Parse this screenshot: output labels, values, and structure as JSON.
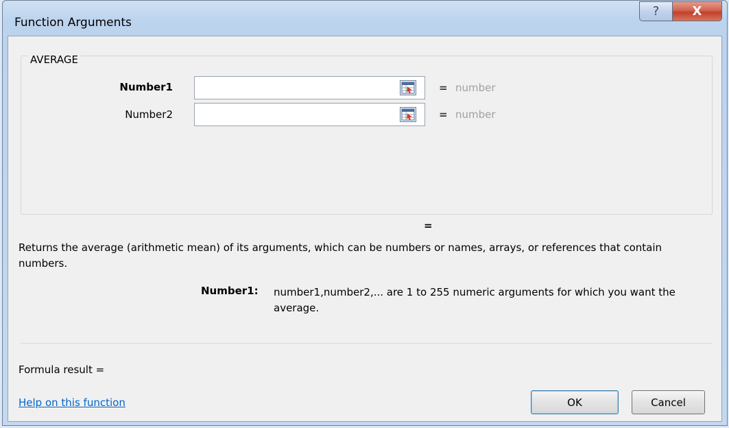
{
  "window": {
    "title": "Function Arguments",
    "help_glyph": "?",
    "close_glyph": "X"
  },
  "function": {
    "name": "AVERAGE"
  },
  "arguments": [
    {
      "label": "Number1",
      "value": "",
      "equals": "=",
      "result": "number",
      "bold": true
    },
    {
      "label": "Number2",
      "value": "",
      "equals": "=",
      "result": "number",
      "bold": false
    }
  ],
  "function_result_equals": "=",
  "description": "Returns the average (arithmetic mean) of its arguments, which can be numbers or names, arrays, or references that contain numbers.",
  "argument_help": {
    "name": "Number1:",
    "text": "number1,number2,... are 1 to 255 numeric arguments for which you want the average."
  },
  "formula_result_label": "Formula result =",
  "help_link": "Help on this function",
  "buttons": {
    "ok": "OK",
    "cancel": "Cancel"
  },
  "icons": {
    "collapse": "range-select-icon",
    "help": "help-icon",
    "close": "close-icon"
  },
  "colors": {
    "link": "#0066cc",
    "close_button": "#c1412a",
    "placeholder_value": "#a0a0a0"
  }
}
